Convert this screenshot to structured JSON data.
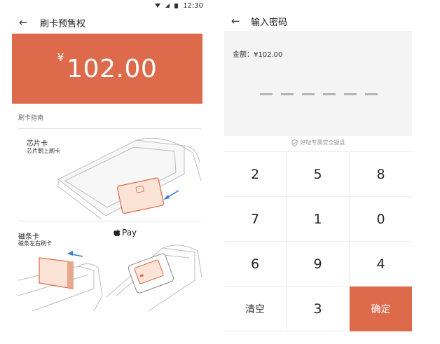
{
  "status_bar": {
    "time": "12:30"
  },
  "left_screen": {
    "title": "刷卡预售权",
    "back_icon": "arrow-left-icon",
    "amount": {
      "currency": "¥",
      "value": "102.00"
    },
    "guide": {
      "title": "刷卡指南",
      "chip": {
        "title": "芯片卡",
        "desc": "芯片朝上刷卡"
      },
      "magstripe": {
        "title": "磁条卡",
        "desc": "磁条左右刷卡"
      },
      "applepay": {
        "icon": "apple-icon",
        "label": "Pay"
      }
    }
  },
  "right_screen": {
    "title": "输入密码",
    "back_icon": "arrow-left-icon",
    "amount_label": "金额：¥102.00",
    "pin_length": 6,
    "safe_notice": "好哒专属安全键盘",
    "keys": [
      "2",
      "5",
      "8",
      "7",
      "1",
      "0",
      "6",
      "9",
      "4"
    ],
    "clear_label": "清空",
    "last_digit": "3",
    "confirm_label": "确定"
  },
  "colors": {
    "accent": "#dd6a4b",
    "panel": "#f4f4f4"
  }
}
